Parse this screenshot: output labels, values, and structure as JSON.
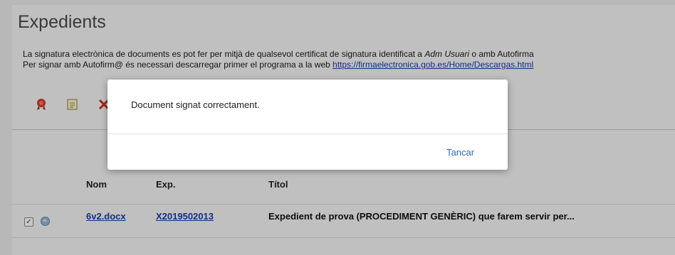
{
  "page": {
    "title": "Expedients"
  },
  "description": {
    "line1_pre": "La signatura electrònica de documents es pot fer per mitjà de qualsevol certificat de signatura identificat a ",
    "line1_em": "Adm Usuari",
    "line1_post": " o amb Autofirma",
    "line2_pre": "Per signar amb Autofirm@ és necessari descarregar primer el programa a la web ",
    "line2_link": "https://firmaelectronica.gob.es/Home/Descargas.html"
  },
  "toolbar": {
    "icons": [
      "sign-seal-icon",
      "edit-document-icon",
      "delete-icon"
    ]
  },
  "table": {
    "headers": {
      "name": "Nom",
      "exp": "Exp.",
      "title": "Títol"
    },
    "rows": [
      {
        "checked": true,
        "name": "6v2.docx",
        "exp": "X2019502013",
        "title": "Expedient de prova (PROCEDIMENT GENÈRIC) que farem servir per..."
      }
    ]
  },
  "dialog": {
    "message": "Document signat correctament.",
    "close_label": "Tancar"
  },
  "colors": {
    "link": "#1a3aa8",
    "dialog_button": "#2d6bc4",
    "background": "#f6f6f6"
  }
}
